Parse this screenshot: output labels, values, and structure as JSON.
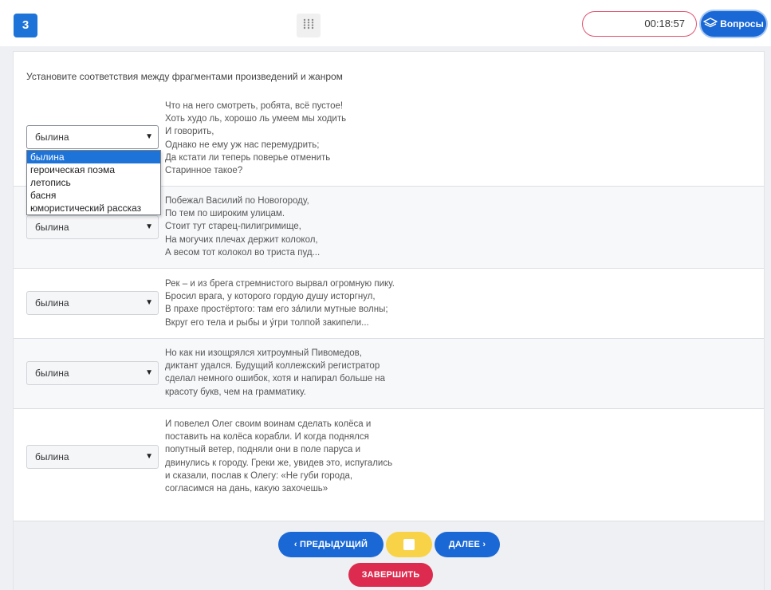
{
  "header": {
    "question_number": "3",
    "timer": "00:18:57",
    "questions_button": "Вопросы",
    "grid_icon": "grid-dots-icon",
    "questions_icon": "layers-icon"
  },
  "task": {
    "instruction": "Установите соответствия между фрагментами произведений и жанром",
    "items": [
      {
        "selected": "былина",
        "lines": [
          "Что на него смотреть, робята, всё пустое!",
          "Хоть худо ль, хорошо ль умеем мы ходить",
          "И говорить,",
          "Однако не ему уж нас перемудрить;",
          "Да кстати ли теперь поверье отменить",
          "Старинное такое?"
        ]
      },
      {
        "selected": "былина",
        "lines": [
          "Побежал Василий по Новогороду,",
          "По тем по широким улицам.",
          "Стоит тут старец-пилигримище,",
          "На могучих плечах держит колокол,",
          "А весом тот колокол во триста пуд..."
        ]
      },
      {
        "selected": "былина",
        "lines": [
          "Рек – и из брега стремнистого вырвал огромную пику.",
          "Бросил врага, у которого гордую душу исторгнул,",
          "В прахе простёртого: там его за́лили мутные волны;",
          "Вкруг его тела и рыбы и у́гри толпой закипели..."
        ]
      },
      {
        "selected": "былина",
        "lines": [
          "Но как ни изощрялся хитроумный Пивомедов,",
          "диктант удался. Будущий коллежский регистратор",
          "сделал немного ошибок, хотя и напирал больше на",
          "красоту букв, чем на грамматику."
        ]
      },
      {
        "selected": "былина",
        "lines": [
          "И повелел Олег своим воинам сделать колёса и",
          "поставить на колёса корабли. И когда поднялся",
          "попутный ветер, подняли они в поле паруса и",
          "двинулись к городу. Греки же, увидев это, испугались",
          "и сказали, послав к Олегу: «Не губи города,",
          "согласимся на дань, какую захочешь»"
        ]
      }
    ],
    "dropdown_options": [
      "былина",
      "героическая поэма",
      "летопись",
      "басня",
      "юмористический рассказ"
    ]
  },
  "footer": {
    "prev_label": "‹ ПРЕДЫДУЩИЙ",
    "next_label": "ДАЛЕЕ ›",
    "finish_label": "ЗАВЕРШИТЬ"
  },
  "colors": {
    "primary_blue": "#1a68d6",
    "finish_red": "#dc2b4e",
    "mark_yellow": "#f8d347",
    "timer_border": "#e2526e"
  }
}
